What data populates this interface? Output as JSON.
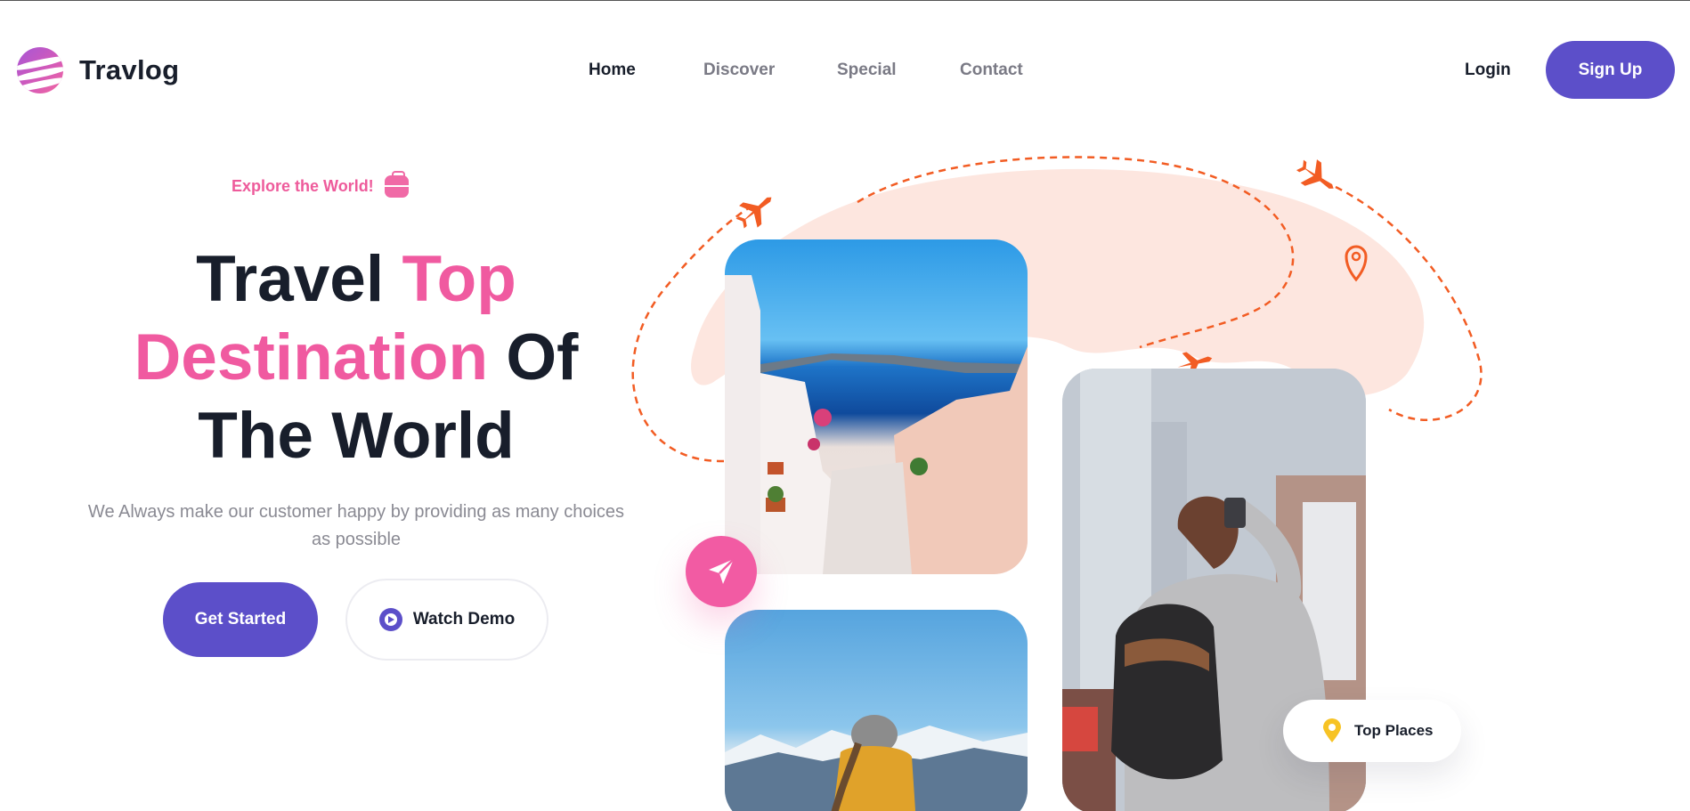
{
  "brand": {
    "name": "Travlog",
    "logo_icon": "globe-stripes-icon"
  },
  "nav": {
    "items": [
      {
        "label": "Home",
        "active": true
      },
      {
        "label": "Discover",
        "active": false
      },
      {
        "label": "Special",
        "active": false
      },
      {
        "label": "Contact",
        "active": false
      }
    ]
  },
  "auth": {
    "login_label": "Login",
    "signup_label": "Sign Up"
  },
  "hero": {
    "tagline": "Explore the World!",
    "tagline_icon": "briefcase-icon",
    "headline": {
      "line1_dark": "Travel",
      "line1_pink": "Top",
      "line2_pink": "Destination",
      "line2_dark": "Of",
      "line3_dark": "The World"
    },
    "subtitle": "We Always make our customer happy by providing as many choices as possible",
    "primary_cta": "Get Started",
    "secondary_cta": "Watch Demo",
    "secondary_cta_icon": "play-circle-icon"
  },
  "gallery": {
    "photos": [
      "santorini-stairs-photo",
      "mountain-traveler-photo",
      "city-backpacker-photo"
    ],
    "send_icon": "paper-plane-icon",
    "badge_label": "Top Places",
    "badge_icon": "location-pin-icon"
  },
  "colors": {
    "primary": "#5c4fc9",
    "accent_pink": "#f05aa0",
    "accent_orange": "#f25c23",
    "text_dark": "#181e2b",
    "text_muted": "#8a8a93",
    "map_tint": "#fde6df",
    "badge_yellow": "#f7c325"
  }
}
